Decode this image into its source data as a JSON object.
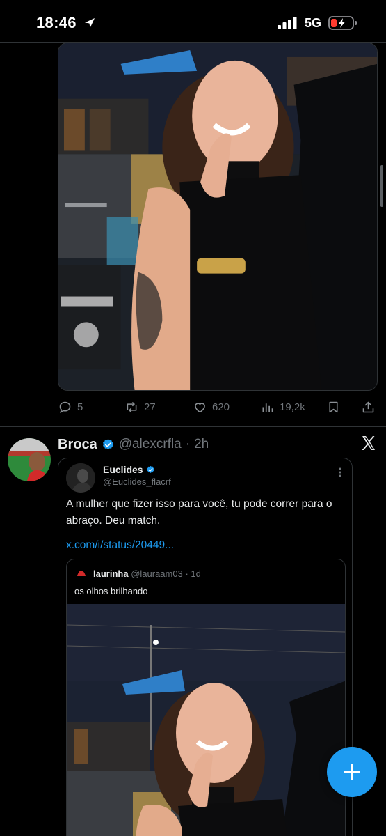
{
  "status_bar": {
    "time": "18:46",
    "network": "5G",
    "icons": [
      "location-arrow-icon",
      "signal-bars-icon",
      "battery-low-charging-icon"
    ]
  },
  "tweet1": {
    "image": "woman-smiling-street-night-photo",
    "actions": {
      "replies": "5",
      "reposts": "27",
      "likes": "620",
      "views": "19,2k"
    }
  },
  "tweet2": {
    "name": "Broca",
    "handle": "@alexcrfla",
    "time": "2h",
    "platform_icon": "x-logo-icon",
    "quote": {
      "name": "Euclides",
      "handle": "@Euclides_flacrf",
      "text": "A mulher que fizer isso para você, tu pode correr para o abraço. Deu match.",
      "link": "x.com/i/status/20449...",
      "inner": {
        "name": "laurinha",
        "handle": "@lauraam03",
        "time": "1d",
        "text": "os olhos brilhando"
      }
    }
  },
  "colors": {
    "background": "#000000",
    "accent": "#1d9bf0",
    "muted": "#71767b",
    "border": "#2f3336"
  }
}
